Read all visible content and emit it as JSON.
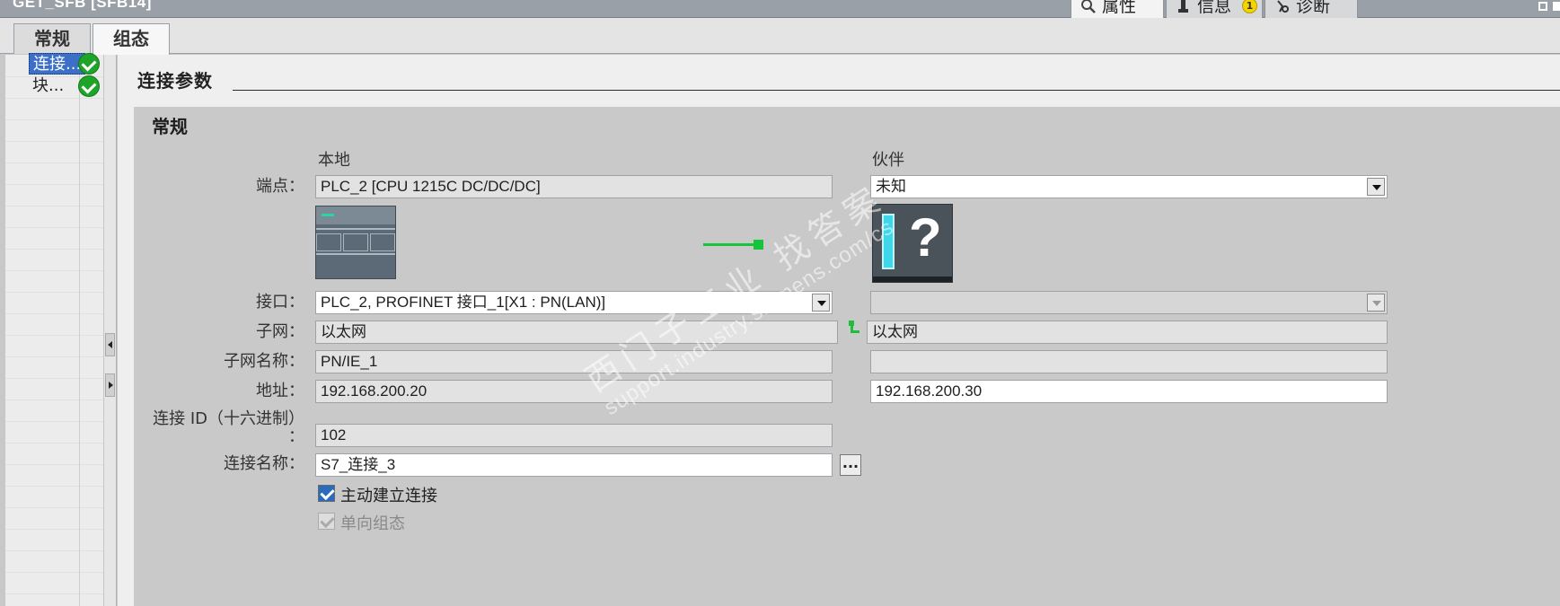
{
  "window": {
    "title": "GET_SFB [SFB14]"
  },
  "panel_tabs": [
    {
      "label": "属性"
    },
    {
      "label": "信息",
      "badge": "1"
    },
    {
      "label": "诊断"
    }
  ],
  "tabs": [
    {
      "label": "常规"
    },
    {
      "label": "组态"
    }
  ],
  "nav": [
    {
      "label": "连接...",
      "status": "ok-check-icon"
    },
    {
      "label": "块...",
      "status": "ok-check-icon"
    }
  ],
  "section_title": "连接参数",
  "group_title": "常规",
  "columns": {
    "local": "本地",
    "partner": "伙伴"
  },
  "labels": {
    "endpoint": "端点：",
    "interface": "接口：",
    "subnet": "子网：",
    "subnet_name": "子网名称：",
    "address": "地址：",
    "conn_id_line1": "连接 ID（十六进制）",
    "conn_id_line2": "：",
    "conn_name": "连接名称："
  },
  "local": {
    "endpoint": "PLC_2 [CPU 1215C DC/DC/DC]",
    "interface": "PLC_2, PROFINET 接口_1[X1 : PN(LAN)]",
    "subnet": "以太网",
    "subnet_name": "PN/IE_1",
    "address": "192.168.200.20",
    "conn_id": "102",
    "conn_name": "S7_连接_3"
  },
  "partner": {
    "endpoint": "未知",
    "interface": "",
    "subnet": "以太网",
    "subnet_name": "",
    "address": "192.168.200.30"
  },
  "checkboxes": [
    {
      "label": "主动建立连接",
      "checked": true,
      "enabled": true
    },
    {
      "label": "单向组态",
      "checked": true,
      "enabled": false
    }
  ],
  "browse_button": "...",
  "watermark": {
    "line1": "西门子工业 找答案",
    "line2": "support.industry.siemens.com/cs"
  },
  "colors": {
    "accent": "#3c6fc8",
    "ok": "#1fa42a",
    "link": "#16c43a"
  }
}
